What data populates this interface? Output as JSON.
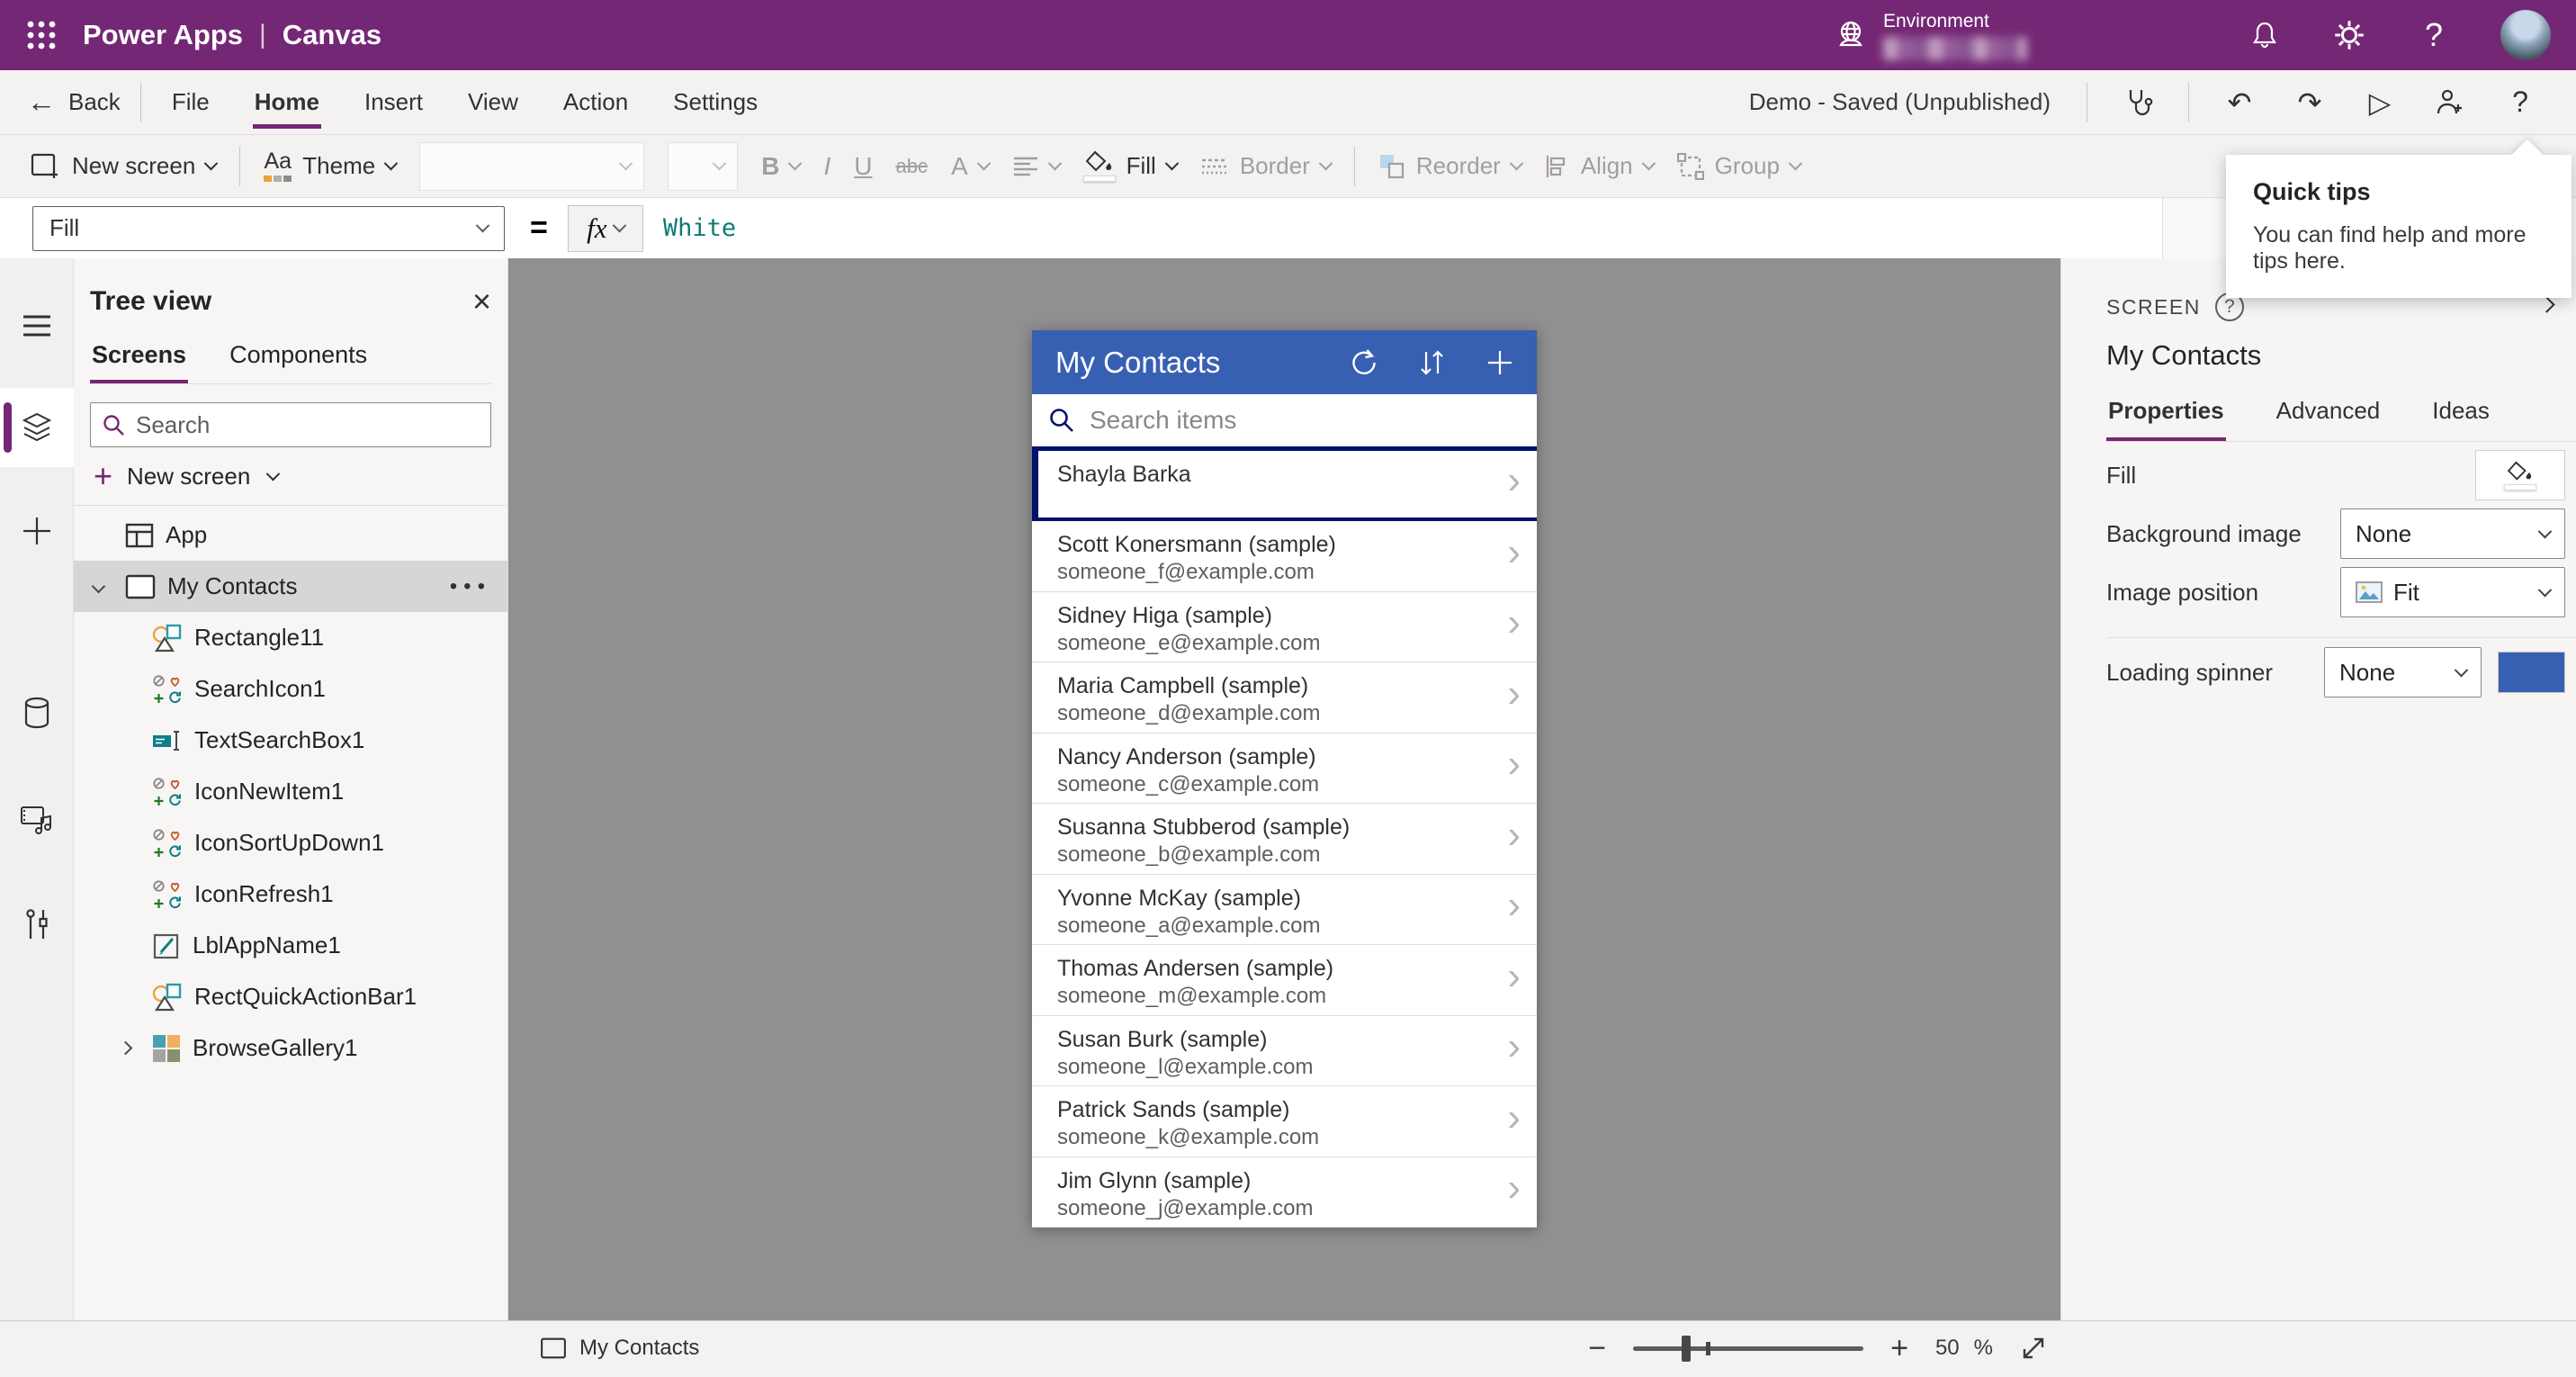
{
  "top_bar": {
    "product": "Power Apps",
    "separator": "|",
    "mode": "Canvas",
    "environment_label": "Environment"
  },
  "menu_bar": {
    "back_label": "Back",
    "back_arrow": "←",
    "items": [
      {
        "label": "File"
      },
      {
        "label": "Home",
        "active": true
      },
      {
        "label": "Insert"
      },
      {
        "label": "View"
      },
      {
        "label": "Action"
      },
      {
        "label": "Settings"
      }
    ],
    "status": "Demo - Saved (Unpublished)",
    "undo_glyph": "↶",
    "redo_glyph": "↷",
    "play_glyph": "▷",
    "help_glyph": "?"
  },
  "ribbon": {
    "new_screen": "New screen",
    "theme_glyph": "Aa",
    "theme": "Theme",
    "bold": "B",
    "italic": "I",
    "underline": "U",
    "strikethrough": "abc",
    "font_color": "A",
    "fill": "Fill",
    "border": "Border",
    "reorder": "Reorder",
    "align": "Align",
    "group": "Group"
  },
  "formula_bar": {
    "property": "Fill",
    "equals": "=",
    "fx": "fx",
    "value": "White"
  },
  "tree_panel": {
    "title": "Tree view",
    "close_glyph": "×",
    "tabs": [
      {
        "label": "Screens",
        "active": true
      },
      {
        "label": "Components"
      }
    ],
    "search_placeholder": "Search",
    "new_screen": "New screen",
    "items": [
      {
        "icon": "app",
        "label": "App"
      },
      {
        "icon": "screen",
        "label": "My Contacts",
        "selected": true,
        "expanded": true,
        "more": "•••"
      },
      {
        "icon": "rectangle",
        "label": "Rectangle11",
        "indent": true
      },
      {
        "icon": "custom-icon",
        "label": "SearchIcon1",
        "indent": true
      },
      {
        "icon": "textbox",
        "label": "TextSearchBox1",
        "indent": true
      },
      {
        "icon": "custom-icon",
        "label": "IconNewItem1",
        "indent": true
      },
      {
        "icon": "custom-icon",
        "label": "IconSortUpDown1",
        "indent": true
      },
      {
        "icon": "custom-icon",
        "label": "IconRefresh1",
        "indent": true
      },
      {
        "icon": "label",
        "label": "LblAppName1",
        "indent": true
      },
      {
        "icon": "rectangle",
        "label": "RectQuickActionBar1",
        "indent": true
      },
      {
        "icon": "gallery",
        "label": "BrowseGallery1",
        "indent": true,
        "expandable": true
      }
    ]
  },
  "phone_app": {
    "title": "My Contacts",
    "search_placeholder": "Search items",
    "row_chevron": "›",
    "contacts": [
      {
        "name": "Shayla Barka",
        "email": "",
        "selected": true
      },
      {
        "name": "Scott Konersmann (sample)",
        "email": "someone_f@example.com"
      },
      {
        "name": "Sidney Higa (sample)",
        "email": "someone_e@example.com"
      },
      {
        "name": "Maria Campbell (sample)",
        "email": "someone_d@example.com"
      },
      {
        "name": "Nancy Anderson (sample)",
        "email": "someone_c@example.com"
      },
      {
        "name": "Susanna Stubberod (sample)",
        "email": "someone_b@example.com"
      },
      {
        "name": "Yvonne McKay (sample)",
        "email": "someone_a@example.com"
      },
      {
        "name": "Thomas Andersen (sample)",
        "email": "someone_m@example.com"
      },
      {
        "name": "Susan Burk (sample)",
        "email": "someone_l@example.com"
      },
      {
        "name": "Patrick Sands (sample)",
        "email": "someone_k@example.com"
      },
      {
        "name": "Jim Glynn (sample)",
        "email": "someone_j@example.com"
      }
    ]
  },
  "props_panel": {
    "kind": "SCREEN",
    "help_glyph": "?",
    "name": "My Contacts",
    "tabs": [
      {
        "label": "Properties",
        "active": true
      },
      {
        "label": "Advanced"
      },
      {
        "label": "Ideas"
      }
    ],
    "fill_label": "Fill",
    "background_image_label": "Background image",
    "background_image_value": "None",
    "image_position_label": "Image position",
    "image_position_value": "Fit",
    "loading_spinner_label": "Loading spinner",
    "loading_spinner_value": "None",
    "spinner_color": "#3860b2"
  },
  "status_bar": {
    "screen_name": "My Contacts",
    "minus": "−",
    "plus": "+",
    "zoom_value": "50",
    "percent": "%"
  },
  "quick_tips": {
    "title": "Quick tips",
    "body": "You can find help and more tips here."
  },
  "colors": {
    "brand_purple": "#742774",
    "app_header_blue": "#3860b2",
    "selection_navy": "#00126b",
    "formula_teal": "#0e7a75",
    "canvas_gray": "#909090"
  }
}
